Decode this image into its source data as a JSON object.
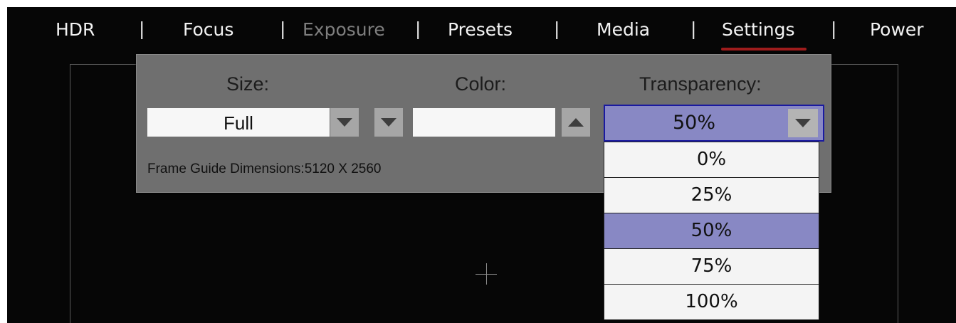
{
  "menu": {
    "items": [
      {
        "label": "HDR",
        "disabled": false
      },
      {
        "label": "Focus",
        "disabled": false
      },
      {
        "label": "Exposure",
        "disabled": true
      },
      {
        "label": "Presets",
        "disabled": false
      },
      {
        "label": "Media",
        "disabled": false
      },
      {
        "label": "Settings",
        "disabled": false,
        "active": true
      },
      {
        "label": "Power",
        "disabled": false
      }
    ],
    "separator": "|"
  },
  "panel": {
    "size_label": "Size:",
    "color_label": "Color:",
    "transparency_label": "Transparency:",
    "size_value": "Full",
    "color_value": "",
    "transparency_value": "50%",
    "dimensions_text": "Frame Guide Dimensions:5120 X 2560"
  },
  "transparency_options": [
    "0%",
    "25%",
    "50%",
    "75%",
    "100%"
  ],
  "transparency_selected_index": 2,
  "colors": {
    "active_underline": "#9e1c1c",
    "selection_highlight": "#8888c4",
    "panel_bg": "#6f6f6f"
  },
  "icons": [
    "dropdown-arrow-icon",
    "up-arrow-icon",
    "crosshair-icon"
  ]
}
